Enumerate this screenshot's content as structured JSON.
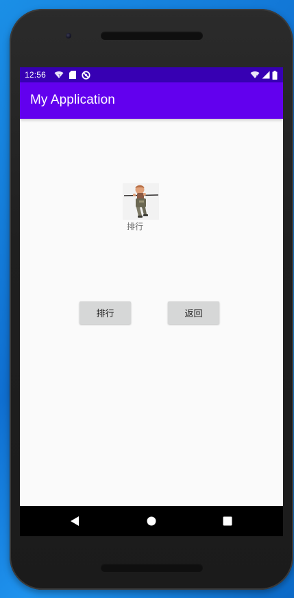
{
  "status_bar": {
    "time": "12:56",
    "left_icons": [
      "wifi-question-icon",
      "sd-card-icon",
      "no-sync-icon"
    ],
    "right_icons": [
      "wifi-x-icon",
      "cellular-signal-icon",
      "battery-icon"
    ]
  },
  "app_bar": {
    "title": "My Application",
    "background": "#6200ee",
    "status_background": "#3700b3"
  },
  "main": {
    "avatar_icon": "character-figure-icon",
    "avatar_label": "排行",
    "buttons": [
      {
        "label": "排行"
      },
      {
        "label": "返回"
      }
    ]
  },
  "nav_bar": {
    "icons": [
      "back-triangle-icon",
      "home-circle-icon",
      "recent-square-icon"
    ]
  }
}
